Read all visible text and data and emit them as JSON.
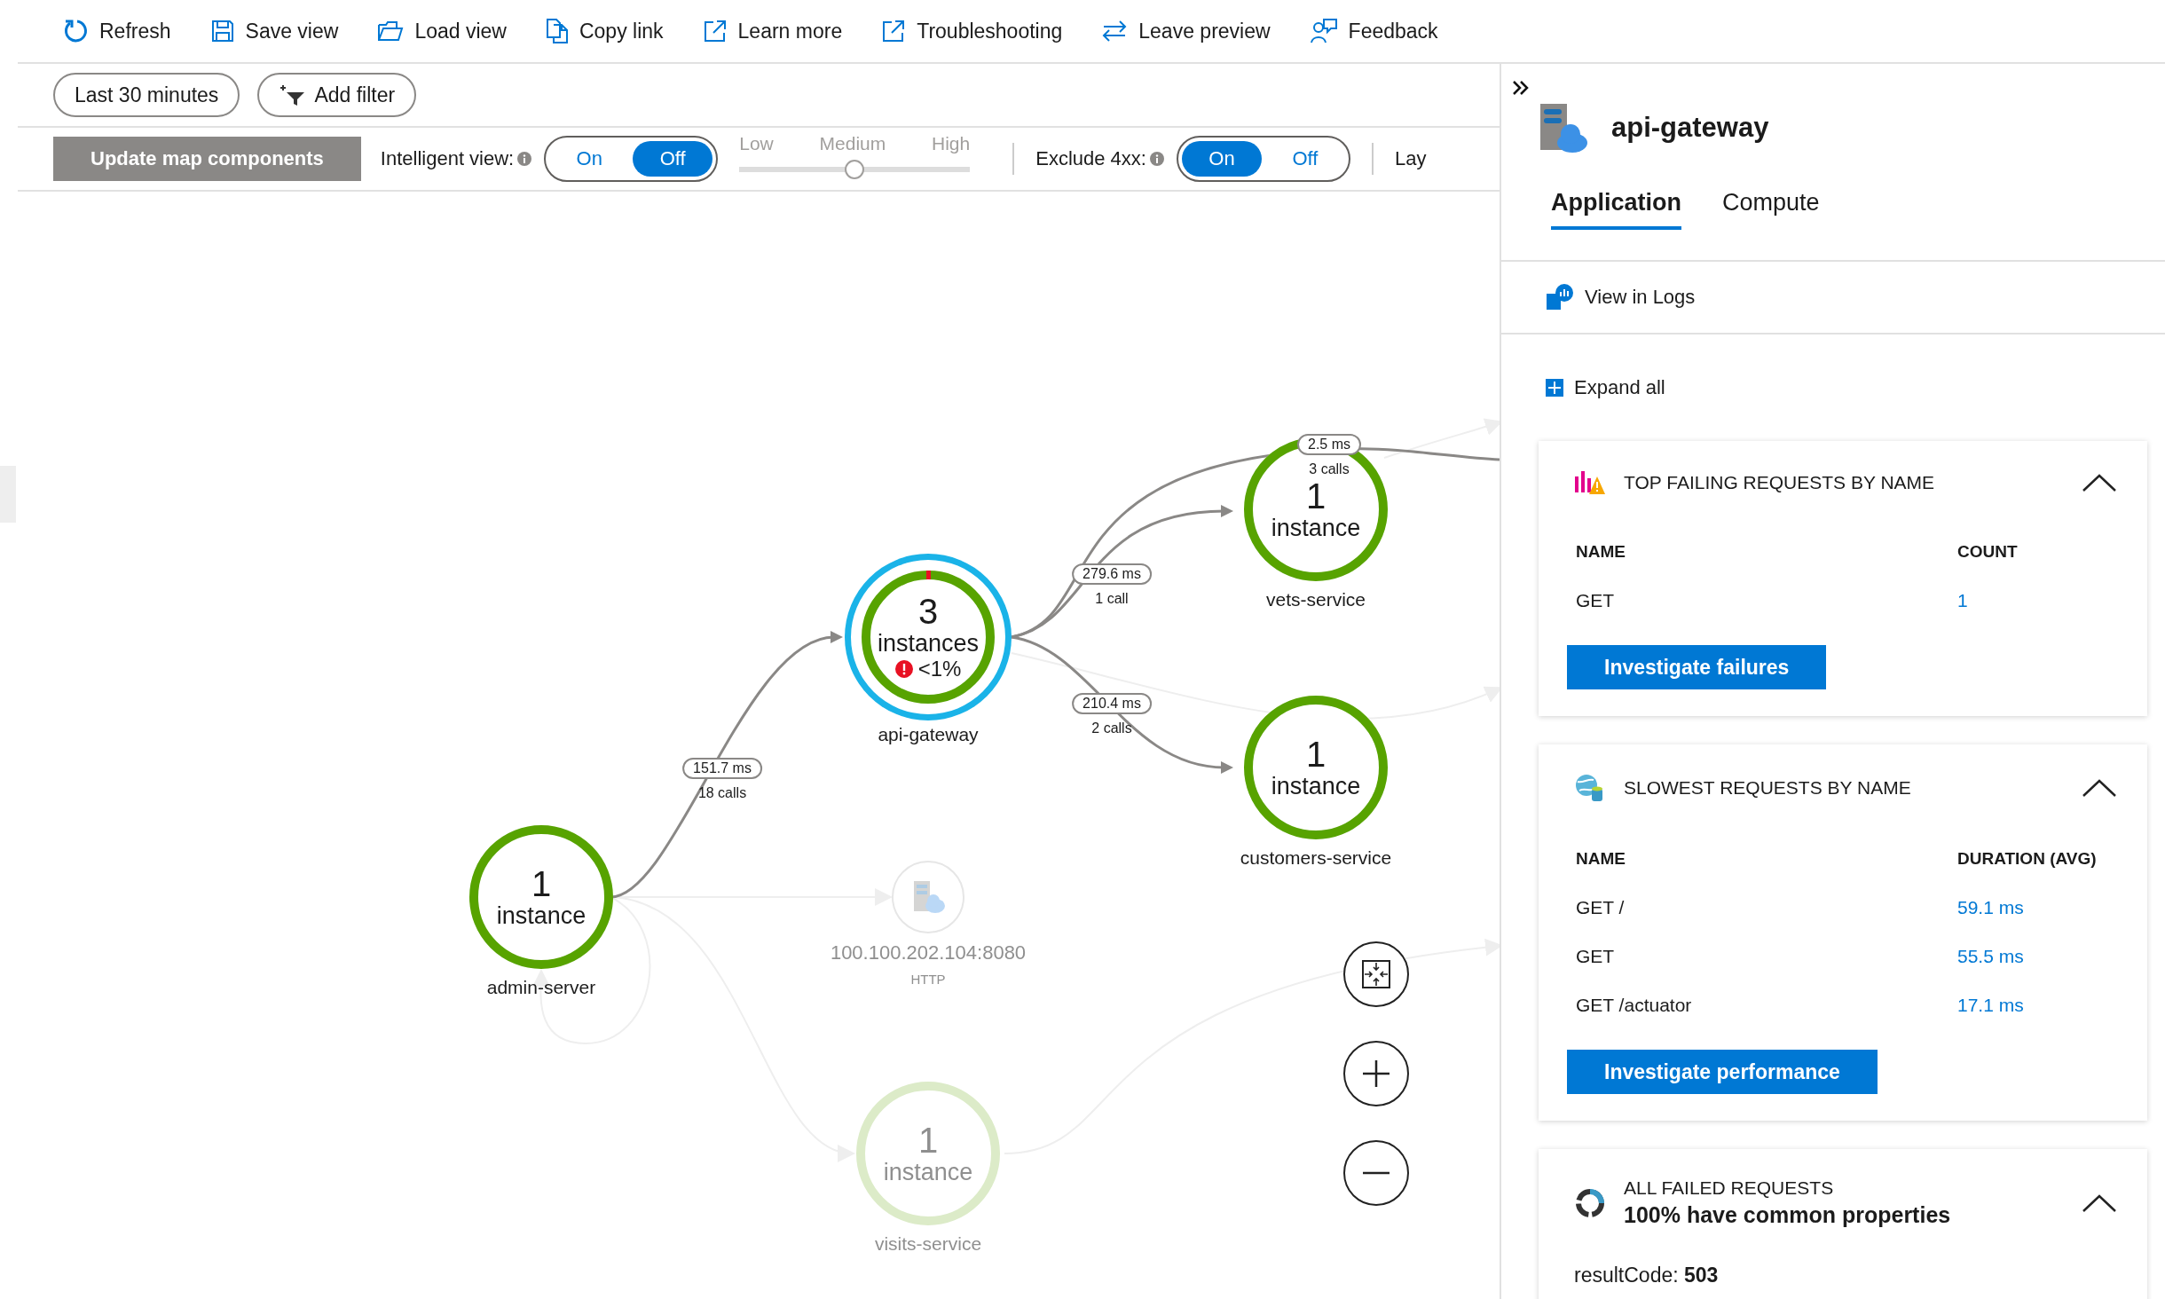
{
  "toolbar": [
    {
      "label": "Refresh"
    },
    {
      "label": "Save view"
    },
    {
      "label": "Load view"
    },
    {
      "label": "Copy link"
    },
    {
      "label": "Learn more"
    },
    {
      "label": "Troubleshooting"
    },
    {
      "label": "Leave preview"
    },
    {
      "label": "Feedback"
    }
  ],
  "filters": {
    "time_range": "Last 30 minutes",
    "add_filter": "Add filter"
  },
  "controls": {
    "update_button": "Update map components",
    "intelligent_view": {
      "label": "Intelligent view:",
      "options": [
        {
          "label": "On",
          "selected": false
        },
        {
          "label": "Off",
          "selected": true
        }
      ]
    },
    "sensitivity": {
      "labels": [
        "Low",
        "Medium",
        "High"
      ],
      "level": 0.5
    },
    "exclude_4xx": {
      "label": "Exclude 4xx:",
      "options": [
        {
          "label": "On",
          "selected": true
        },
        {
          "label": "Off",
          "selected": false
        }
      ]
    },
    "layout_label": "Lay"
  },
  "map": {
    "nodes": [
      {
        "kind": "service",
        "count": "1",
        "unit": "instance",
        "name": "admin-server",
        "selected": false,
        "faded": false
      },
      {
        "kind": "service",
        "count": "3",
        "unit": "instances",
        "error_rate": "<1%",
        "name": "api-gateway",
        "selected": true,
        "faded": false
      },
      {
        "kind": "service",
        "count": "1",
        "unit": "instance",
        "name": "vets-service",
        "selected": false,
        "faded": false
      },
      {
        "kind": "service",
        "count": "1",
        "unit": "instance",
        "name": "customers-service",
        "selected": false,
        "faded": false
      },
      {
        "kind": "endpoint",
        "name": "100.100.202.104:8080",
        "protocol": "HTTP",
        "selected": false,
        "faded": true
      },
      {
        "kind": "service",
        "count": "1",
        "unit": "instance",
        "name": "visits-service",
        "selected": false,
        "faded": true
      }
    ],
    "edges": [
      {
        "latency": "151.7 ms",
        "calls": "18 calls"
      },
      {
        "latency": "279.6 ms",
        "calls": "1 call"
      },
      {
        "latency": "210.4 ms",
        "calls": "2 calls"
      },
      {
        "latency": "2.5 ms",
        "calls": "3 calls"
      }
    ]
  },
  "panel": {
    "title": "api-gateway",
    "tabs": [
      {
        "label": "Application",
        "selected": true
      },
      {
        "label": "Compute",
        "selected": false
      }
    ],
    "view_in_logs": "View in Logs",
    "expand_all": "Expand all",
    "cards": [
      {
        "kind": "table",
        "title": "TOP FAILING REQUESTS BY NAME",
        "expanded": true,
        "columns": [
          "NAME",
          "COUNT"
        ],
        "rows": [
          [
            "GET",
            "1"
          ]
        ],
        "button": "Investigate failures"
      },
      {
        "kind": "table",
        "title": "SLOWEST REQUESTS BY NAME",
        "expanded": true,
        "columns": [
          "NAME",
          "DURATION (AVG)"
        ],
        "rows": [
          [
            "GET /",
            "59.1 ms"
          ],
          [
            "GET",
            "55.5 ms"
          ],
          [
            "GET /actuator",
            "17.1 ms"
          ]
        ],
        "button": "Investigate performance"
      },
      {
        "kind": "summary",
        "title": "ALL FAILED REQUESTS",
        "subtitle": "100% have common properties",
        "expanded": true,
        "lines": [
          "resultCode: **503**"
        ]
      }
    ]
  }
}
